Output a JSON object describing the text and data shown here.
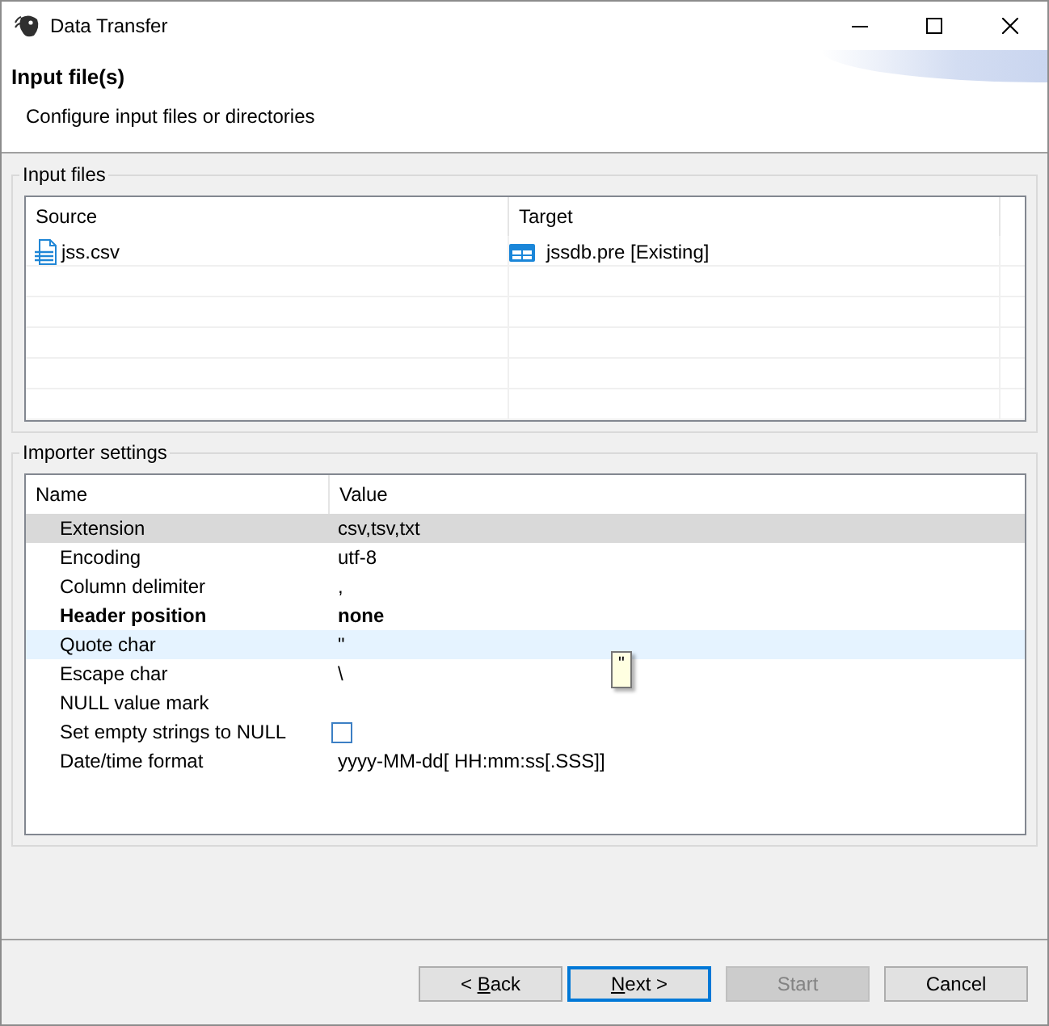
{
  "window": {
    "title": "Data Transfer"
  },
  "header": {
    "title": "Input file(s)",
    "description": "Configure input files or directories"
  },
  "input_files": {
    "label": "Input files",
    "columns": [
      "Source",
      "Target"
    ],
    "rows": [
      {
        "source": "jss.csv",
        "target": "jssdb.pre [Existing]"
      }
    ]
  },
  "importer_settings": {
    "label": "Importer settings",
    "columns": [
      "Name",
      "Value"
    ],
    "rows": [
      {
        "kind": "text",
        "name": "Extension",
        "value": "csv,tsv,txt",
        "selected": true,
        "hovered": false,
        "modified": false
      },
      {
        "kind": "text",
        "name": "Encoding",
        "value": "utf-8",
        "selected": false,
        "hovered": false,
        "modified": false
      },
      {
        "kind": "text",
        "name": "Column delimiter",
        "value": ",",
        "selected": false,
        "hovered": false,
        "modified": false
      },
      {
        "kind": "text",
        "name": "Header position",
        "value": "none",
        "selected": false,
        "hovered": false,
        "modified": true
      },
      {
        "kind": "text",
        "name": "Quote char",
        "value": "\"",
        "selected": false,
        "hovered": true,
        "modified": false
      },
      {
        "kind": "text",
        "name": "Escape char",
        "value": "\\",
        "selected": false,
        "hovered": false,
        "modified": false
      },
      {
        "kind": "text",
        "name": "NULL value mark",
        "selected": false,
        "hovered": false,
        "modified": false
      },
      {
        "kind": "checkbox",
        "name": "Set empty strings to NULL",
        "checked": false,
        "selected": false,
        "hovered": false,
        "modified": false
      },
      {
        "kind": "text",
        "name": "Date/time format",
        "value": "yyyy-MM-dd[ HH:mm:ss[.SSS]]",
        "selected": false,
        "hovered": false,
        "modified": false
      }
    ],
    "tooltip": {
      "text": "\""
    }
  },
  "buttons": [
    {
      "text_before_key": "< ",
      "access_key": "B",
      "text_after_key": "ack",
      "disabled": false,
      "focused": false
    },
    {
      "access_key": "N",
      "text_after_key": "ext >",
      "disabled": false,
      "focused": true
    },
    {
      "label": "Start",
      "disabled": true,
      "focused": false
    },
    {
      "label": "Cancel",
      "disabled": false,
      "focused": false
    }
  ]
}
